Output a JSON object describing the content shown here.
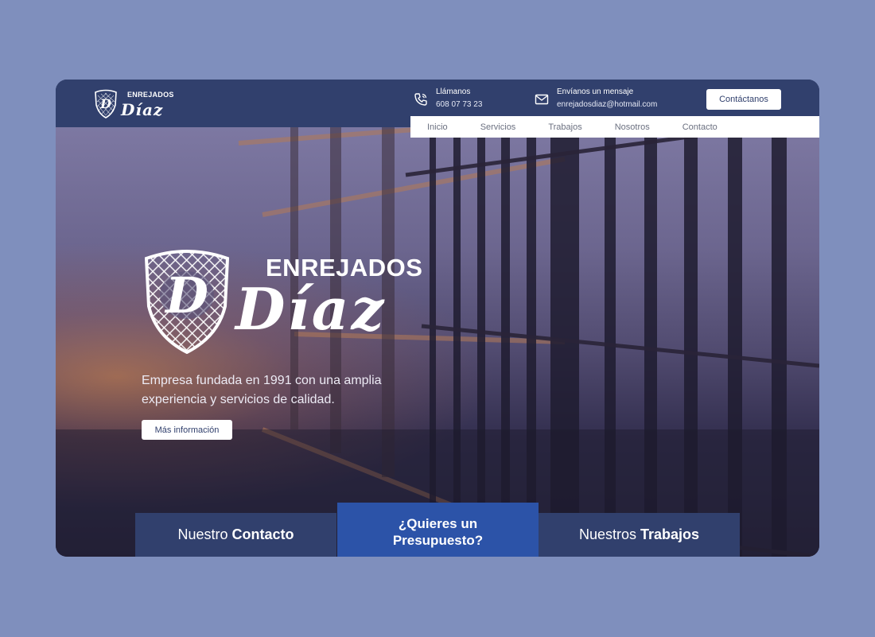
{
  "header": {
    "logo": {
      "brand_top": "ENREJADOS",
      "brand_script": "Díaz"
    },
    "phone": {
      "icon": "phone-icon",
      "label": "Llámanos",
      "value": "608 07 73 23"
    },
    "mail": {
      "icon": "mail-icon",
      "label": "Envíanos un mensaje",
      "value": "enrejadosdiaz@hotmail.com"
    },
    "cta_label": "Contáctanos"
  },
  "nav": {
    "items": [
      {
        "label": "Inicio"
      },
      {
        "label": "Servicios"
      },
      {
        "label": "Trabajos"
      },
      {
        "label": "Nosotros"
      },
      {
        "label": "Contacto"
      }
    ]
  },
  "hero": {
    "brand_top": "ENREJADOS",
    "brand_script": "Díaz",
    "description": "Empresa fundada en 1991 con una amplia experiencia y servicios de calidad.",
    "button_label": "Más información"
  },
  "panels": {
    "contact": {
      "prefix": "Nuestro",
      "bold": "Contacto"
    },
    "quote": {
      "text": "¿Quieres un Presupuesto?"
    },
    "works": {
      "prefix": "Nuestros",
      "bold": "Trabajos"
    }
  },
  "colors": {
    "page_background": "#7f8fbd",
    "header_bar": "#31406d",
    "accent_blue": "#2c53a8"
  }
}
